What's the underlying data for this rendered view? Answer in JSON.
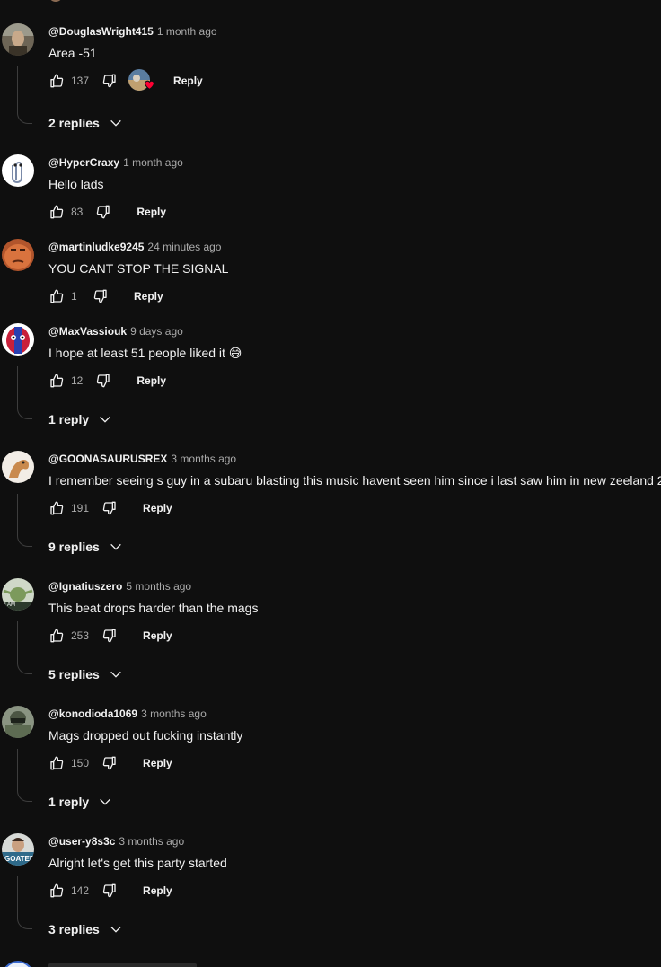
{
  "comments": [
    {
      "author": "@DouglasWright415",
      "time": "1 month ago",
      "text": "Area -51",
      "likes": "137",
      "reply": "Reply",
      "hearted": true,
      "replies": "2 replies",
      "avatar": "portrait-avatar"
    },
    {
      "author": "@HyperCraxy",
      "time": "1 month ago",
      "text": "Hello lads",
      "likes": "83",
      "reply": "Reply",
      "hearted": false,
      "replies": "",
      "avatar": "paperclip-avatar"
    },
    {
      "author": "@martinludke9245",
      "time": "24 minutes ago",
      "text": "YOU CANT STOP THE SIGNAL",
      "likes": "1",
      "reply": "Reply",
      "hearted": false,
      "replies": "",
      "avatar": "face-avatar"
    },
    {
      "author": "@MaxVassiouk",
      "time": "9 days ago",
      "text": "I hope at least 51 people liked it 😅",
      "likes": "12",
      "reply": "Reply",
      "hearted": false,
      "replies": "1 reply",
      "avatar": "spider-avatar"
    },
    {
      "author": "@GOONASAURUSREX",
      "time": "3 months ago",
      "text": "I remember seeing s guy in a subaru blasting this music havent seen him since i last saw him in new zeeland 2",
      "likes": "191",
      "reply": "Reply",
      "hearted": false,
      "replies": "9 replies",
      "avatar": "dino-avatar"
    },
    {
      "author": "@Ignatiuszero",
      "time": "5 months ago",
      "text": "This beat drops harder than the mags",
      "likes": "253",
      "reply": "Reply",
      "hearted": false,
      "replies": "5 replies",
      "avatar": "yoda-avatar"
    },
    {
      "author": "@konodioda1069",
      "time": "3 months ago",
      "text": "Mags dropped out fucking instantly",
      "likes": "150",
      "reply": "Reply",
      "hearted": false,
      "replies": "1 reply",
      "avatar": "soldier-avatar"
    },
    {
      "author": "@user-y8s3c",
      "time": "3 months ago",
      "text": "Alright let's get this party started",
      "likes": "142",
      "reply": "Reply",
      "hearted": false,
      "replies": "3 replies",
      "avatar": "goated-avatar"
    }
  ],
  "avatar_text": {
    "goated": "GOATED",
    "yoda": "I AM"
  },
  "colors": {
    "background": "#0f0f0f",
    "text": "#f1f1f1",
    "muted": "#aaaaaa",
    "heart": "#ff0033"
  }
}
